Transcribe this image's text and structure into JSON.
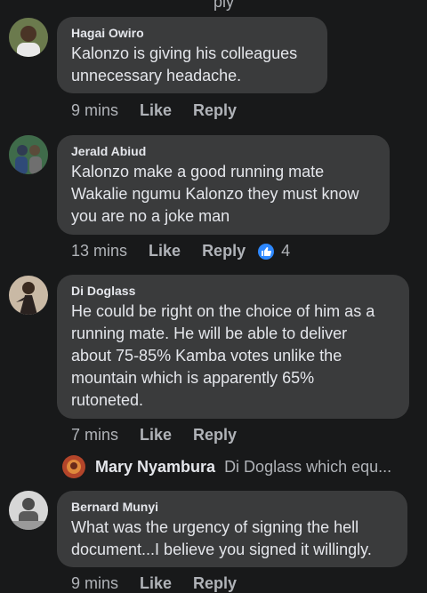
{
  "top_fragment": "ply",
  "comments": [
    {
      "author": "Hagai Owiro",
      "text": "Kalonzo is giving his colleagues\nunnecessary headache.",
      "time": "9 mins",
      "like": "Like",
      "reply": "Reply"
    },
    {
      "author": "Jerald Abiud",
      "text": "Kalonzo make a good running mate\nWakalie ngumu Kalonzo they must know\nyou are no a joke man",
      "time": "13 mins",
      "like": "Like",
      "reply": "Reply",
      "reaction_count": "4"
    },
    {
      "author": "Di Doglass",
      "text": "He could be right on the choice of him as a\nrunning mate. He will be able to deliver\nabout 75-85% Kamba votes unlike the\nmountain which is apparently 65%\nrutoneted.",
      "time": "7 mins",
      "like": "Like",
      "reply": "Reply"
    },
    {
      "author": "Bernard Munyi",
      "text": "What was the urgency of signing the hell\ndocument...I believe you signed it willingly.",
      "time": "9 mins",
      "like": "Like",
      "reply": "Reply"
    }
  ],
  "reply_preview": {
    "author": "Mary Nyambura",
    "text": "Di Doglass which equ..."
  },
  "colors": {
    "background": "#18191a",
    "bubble": "#3a3b3c",
    "text": "#e4e6eb",
    "secondary": "#b0b3b8",
    "like_blue": "#2d88ff"
  }
}
